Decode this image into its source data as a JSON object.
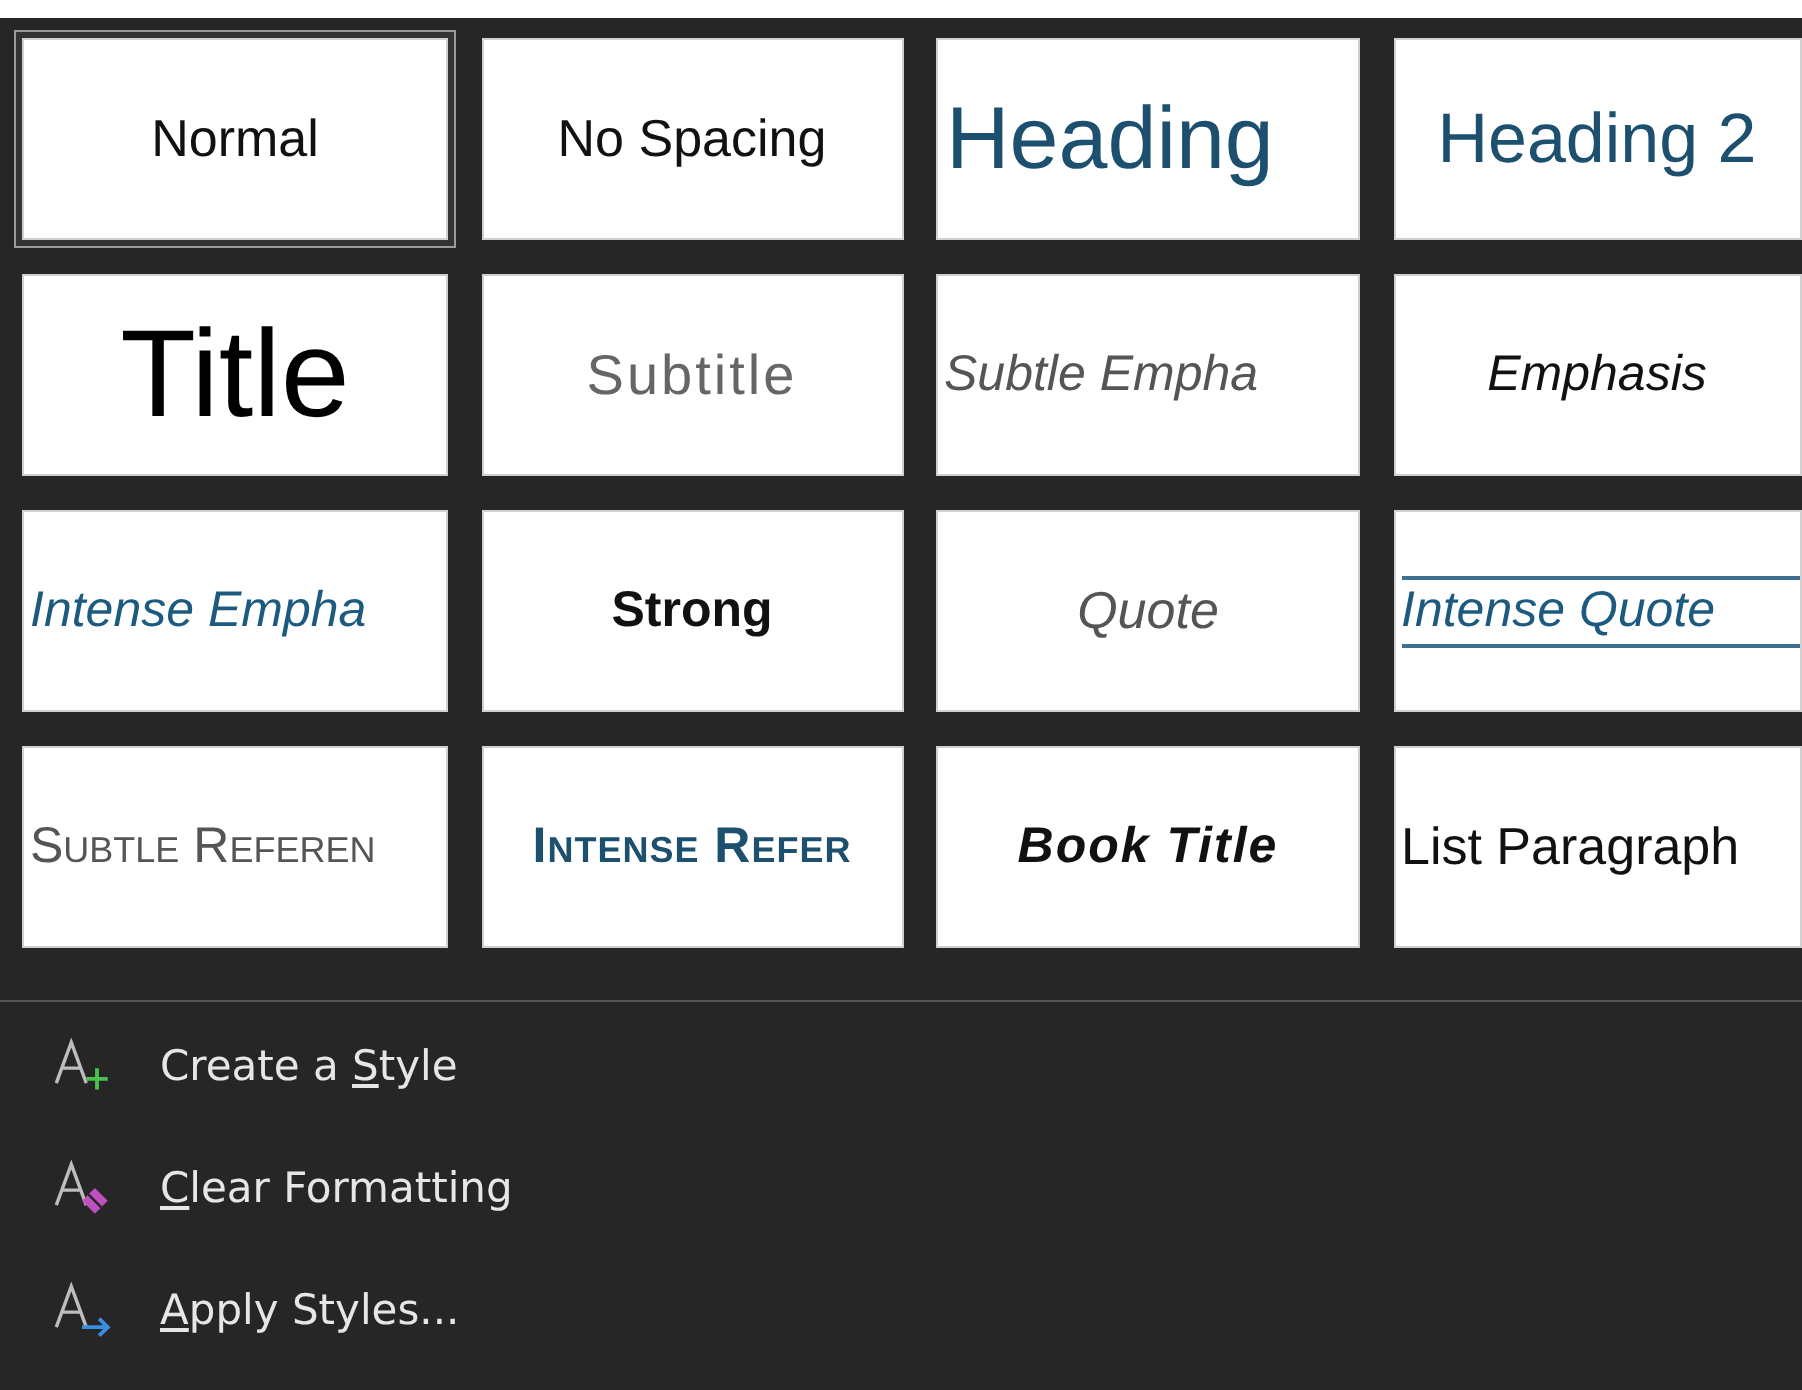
{
  "styles": [
    {
      "label": "Normal",
      "kind": "normal",
      "selected": true
    },
    {
      "label": "No Spacing",
      "kind": "nospacing",
      "selected": false
    },
    {
      "label": "Heading",
      "kind": "heading1",
      "selected": false
    },
    {
      "label": "Heading 2",
      "kind": "heading2",
      "selected": false
    },
    {
      "label": "Title",
      "kind": "title",
      "selected": false
    },
    {
      "label": "Subtitle",
      "kind": "subtitle",
      "selected": false
    },
    {
      "label": "Subtle Empha",
      "kind": "subtleemphasis",
      "selected": false
    },
    {
      "label": "Emphasis",
      "kind": "emphasis",
      "selected": false
    },
    {
      "label": "Intense Empha",
      "kind": "intenseemphasis",
      "selected": false
    },
    {
      "label": "Strong",
      "kind": "strong",
      "selected": false
    },
    {
      "label": "Quote",
      "kind": "quote",
      "selected": false
    },
    {
      "label": "Intense Quote",
      "kind": "intensequote",
      "selected": false
    },
    {
      "label": "Subtle Referen",
      "kind": "subtlereference",
      "selected": false
    },
    {
      "label": "Intense Refer",
      "kind": "intensereference",
      "selected": false
    },
    {
      "label": "Book Title",
      "kind": "booktitle",
      "selected": false
    },
    {
      "label": "List Paragraph",
      "kind": "listparagraph",
      "selected": false
    }
  ],
  "menu": [
    {
      "kind": "create",
      "pre": "Create a ",
      "key": "S",
      "post": "tyle"
    },
    {
      "kind": "clear",
      "key": "C",
      "post": "lear Formatting"
    },
    {
      "kind": "apply",
      "key": "A",
      "post": "pply Styles..."
    }
  ]
}
